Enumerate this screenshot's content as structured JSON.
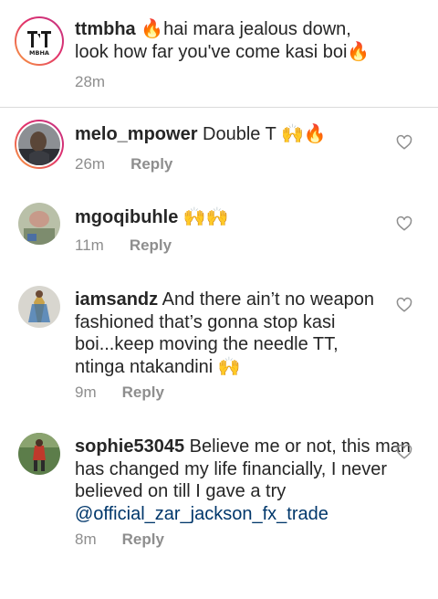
{
  "comments": [
    {
      "username": "ttmbha",
      "text_a": "🔥hai mara jealous down, look how far you've come kasi boi🔥",
      "time": "28m",
      "reply": "",
      "avatar_logo_text": "TT MBHA"
    },
    {
      "username": "melo_mpower",
      "text_a": " Double T 🙌🔥",
      "time": "26m",
      "reply": "Reply"
    },
    {
      "username": "mgoqibuhle",
      "text_a": " 🙌🙌",
      "time": "11m",
      "reply": "Reply"
    },
    {
      "username": "iamsandz",
      "text_a": " And there ain’t no weapon fashioned that’s gonna stop kasi boi...keep moving the needle TT, ntinga ntakandini 🙌",
      "time": "9m",
      "reply": "Reply"
    },
    {
      "username": "sophie53045",
      "text_a": " Believe me or not, this man has changed my life financially, I never believed on till I gave a try ",
      "mention": "@official_zar_jackson_fx_trade",
      "time": "8m",
      "reply": "Reply"
    }
  ],
  "icons": {
    "like": "heart-outline-icon"
  },
  "colors": {
    "text": "#262626",
    "meta": "#8e8e8e",
    "mention": "#00376b",
    "divider": "#dbdbdb"
  }
}
